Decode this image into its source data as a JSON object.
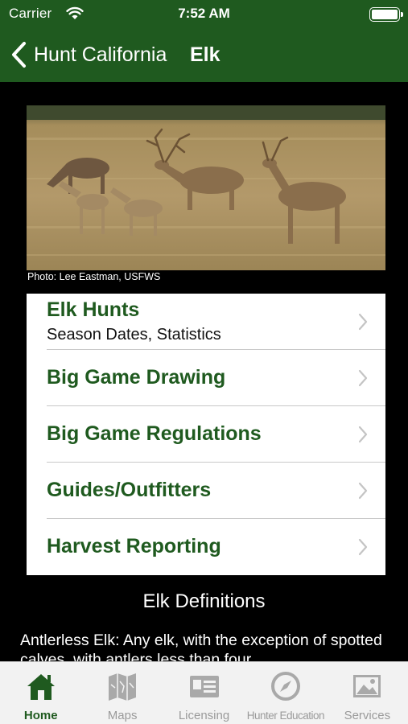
{
  "status_bar": {
    "carrier": "Carrier",
    "time": "7:52 AM",
    "icons": [
      "wifi-icon",
      "battery-icon"
    ]
  },
  "nav": {
    "back_label": "Hunt California",
    "title": "Elk",
    "back_icon": "chevron-left-icon"
  },
  "photo": {
    "subject": "elk herd in grassland",
    "credit": "Photo: Lee Eastman, USFWS"
  },
  "menu": {
    "items": [
      {
        "label": "Elk Hunts",
        "sublabel": "Season Dates, Statistics"
      },
      {
        "label": "Big Game Drawing"
      },
      {
        "label": "Big Game Regulations"
      },
      {
        "label": "Guides/Outfitters"
      },
      {
        "label": "Harvest Reporting"
      }
    ],
    "chevron_icon": "chevron-right-icon"
  },
  "definitions": {
    "title": "Elk Definitions",
    "text": "Antlerless Elk: Any elk, with the exception of spotted calves, with antlers less than four"
  },
  "tab_bar": {
    "tabs": [
      {
        "label": "Home",
        "icon": "home-icon",
        "active": true
      },
      {
        "label": "Maps",
        "icon": "map-icon",
        "active": false
      },
      {
        "label": "Licensing",
        "icon": "license-card-icon",
        "active": false
      },
      {
        "label": "Hunter Education",
        "icon": "compass-icon",
        "active": false
      },
      {
        "label": "Services",
        "icon": "picture-icon",
        "active": false
      }
    ]
  },
  "colors": {
    "brand_green": "#1f5a1f",
    "tab_inactive": "#9a9a9a",
    "background": "#000000"
  }
}
